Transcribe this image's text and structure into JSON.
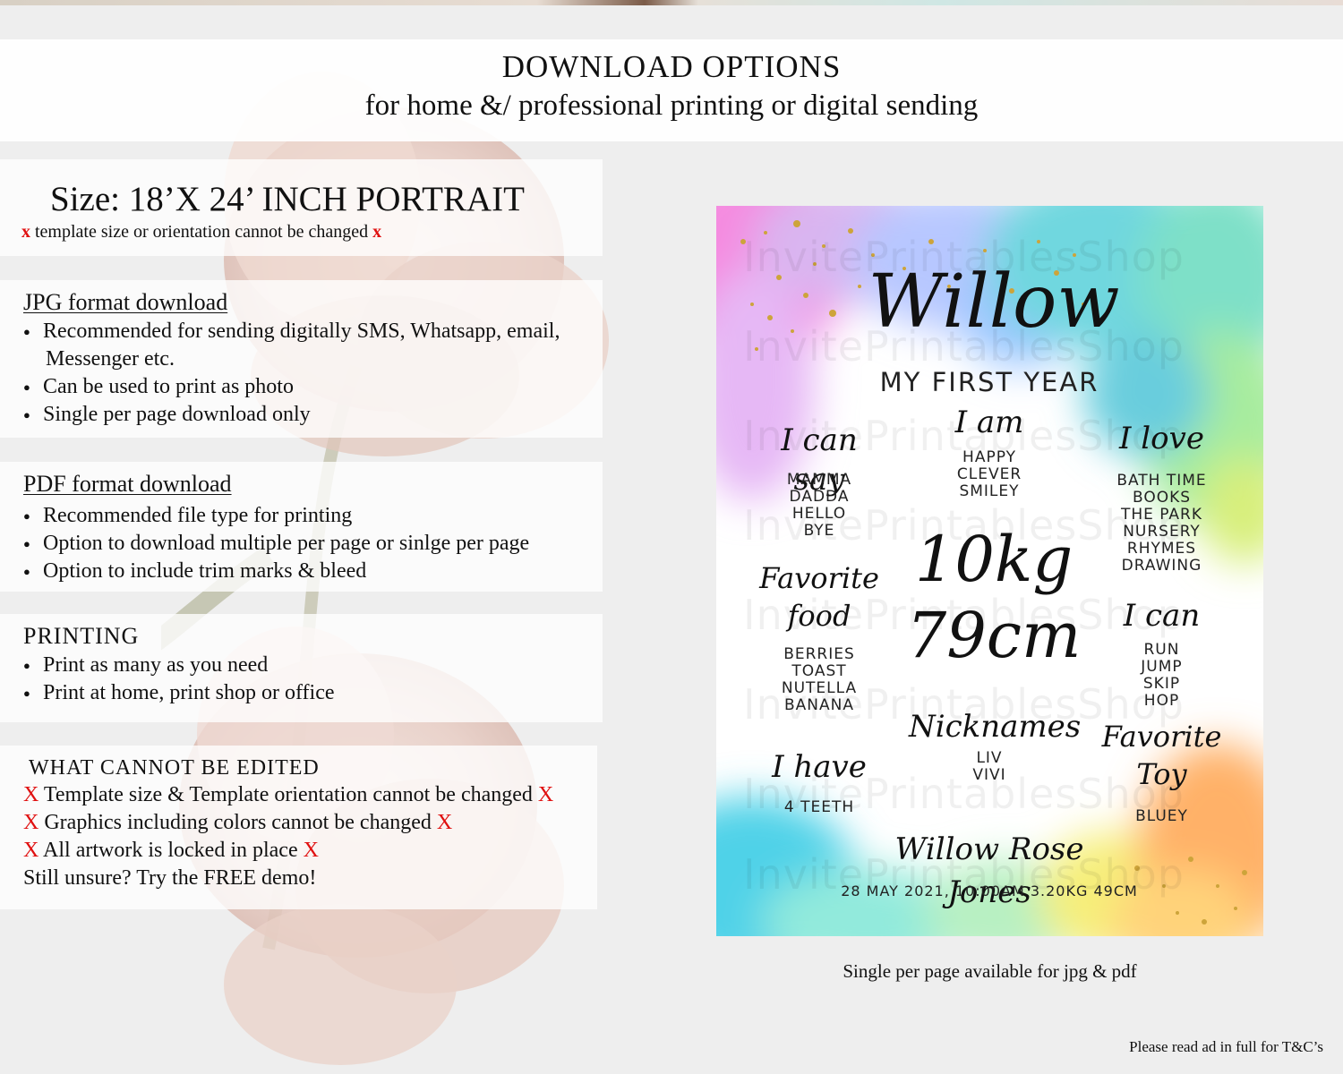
{
  "header": {
    "title": "DOWNLOAD OPTIONS",
    "subtitle": "for home &/ professional printing or digital sending"
  },
  "size_panel": {
    "title": "Size: 18’X 24’ INCH PORTRAIT",
    "x_mark": "x",
    "note": "template size or orientation cannot be changed"
  },
  "jpg_panel": {
    "title": "JPG format download",
    "items": [
      "Recommended for sending digitally SMS, Whatsapp, email,",
      "Can be used to print as photo",
      "Single per page download only"
    ],
    "item0_cont": "Messenger etc."
  },
  "pdf_panel": {
    "title": "PDF format download",
    "items": [
      "Recommended file type for printing",
      "Option to download multiple per page or sinlge per page",
      "Option to include trim marks & bleed"
    ]
  },
  "printing_panel": {
    "title": "PRINTING",
    "items": [
      "Print as many as you need",
      "Print at home, print shop or office"
    ]
  },
  "edit_panel": {
    "title": "WHAT CANNOT BE EDITED",
    "x_mark": "X",
    "items": [
      "Template size & Template orientation cannot be changed",
      "Graphics including colors cannot be changed",
      "All artwork is locked in place"
    ],
    "closing": "Still unsure? Try the FREE demo!"
  },
  "poster": {
    "name": "Willow",
    "subtitle": "MY FIRST YEAR",
    "watermark": "InvitePrintablesShop",
    "i_can_say": {
      "heading": "I can say",
      "items": [
        "MAMMA",
        "DADDA",
        "HELLO",
        "BYE"
      ]
    },
    "i_am": {
      "heading": "I am",
      "items": [
        "HAPPY",
        "CLEVER",
        "SMILEY"
      ]
    },
    "i_love": {
      "heading": "I love",
      "items": [
        "BATH TIME",
        "BOOKS",
        "THE PARK",
        "NURSERY",
        "RHYMES",
        "DRAWING"
      ]
    },
    "weight": "10kg",
    "height": "79cm",
    "favorite_food": {
      "heading_line1": "Favorite",
      "heading_line2": "food",
      "items": [
        "BERRIES",
        "TOAST",
        "NUTELLA",
        "BANANA"
      ]
    },
    "i_can": {
      "heading": "I can",
      "items": [
        "RUN",
        "JUMP",
        "SKIP",
        "HOP"
      ]
    },
    "nicknames": {
      "heading": "Nicknames",
      "items": [
        "LIV",
        "VIVI"
      ]
    },
    "favorite_toy": {
      "heading_line1": "Favorite",
      "heading_line2": "Toy",
      "items": [
        "BLUEY"
      ]
    },
    "i_have": {
      "heading": "I have",
      "items": [
        "4 TEETH"
      ]
    },
    "full_name": "Willow Rose Jones",
    "birth_details": "28 MAY 2021, 10:00AM 3.20KG 49CM"
  },
  "caption": "Single per page available for jpg & pdf",
  "footnote": "Please read ad in full for T&C’s",
  "colors": {
    "x_mark": "#e01010",
    "background": "#eeeeee"
  }
}
